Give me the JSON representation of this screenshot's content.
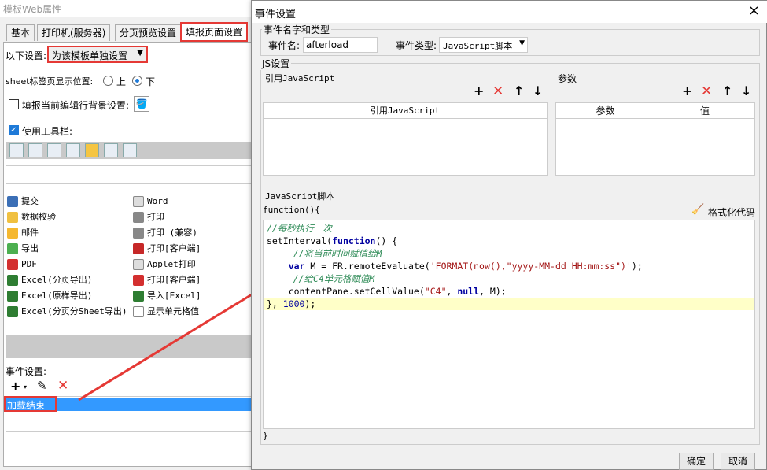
{
  "left_window": {
    "title": "模板Web属性",
    "tabs": [
      "基本",
      "打印机(服务器)",
      "分页预览设置",
      "填报页面设置"
    ],
    "selected_tab": 3,
    "settings_label": "以下设置:",
    "settings_value": "为该模板单独设置",
    "sheet_tab_label": "sheet标签页显示位置:",
    "sheet_tab_top": "上",
    "sheet_tab_bottom": "下",
    "bg_setting_label": "填报当前编辑行背景设置:",
    "toolbar_label": "使用工具栏:",
    "toolbar_items_left": [
      "提交",
      "数据校验",
      "邮件",
      "导出",
      "PDF",
      "Excel(分页导出)",
      "Excel(原样导出)",
      "Excel(分页分Sheet导出)"
    ],
    "toolbar_items_right": [
      "Word",
      "打印",
      "打印 (兼容)",
      "打印[客户端]",
      "Applet打印",
      "打印[客户端]",
      "导入[Excel]",
      "显示单元格值"
    ],
    "event_label": "事件设置:",
    "event_item": "加载结束"
  },
  "dialog": {
    "title": "事件设置",
    "close": "×",
    "name_type_group": "事件名字和类型",
    "event_name_label": "事件名:",
    "event_name_value": "afterload",
    "event_type_label": "事件类型:",
    "event_type_value": "JavaScript脚本",
    "js_group": "JS设置",
    "ref_js_label": "引用JavaScript",
    "ref_js_col": "引用JavaScript",
    "params_label": "参数",
    "params_cols": [
      "参数",
      "值"
    ],
    "script_label": "JavaScript脚本",
    "func_open": "function(){",
    "func_close": "}",
    "format_code": "格式化代码",
    "ok": "确定",
    "cancel": "取消",
    "code_lines": [
      "//每秒执行一次",
      "setInterval(function() {",
      "    //将当前时间赋值给M",
      "    var M = FR.remoteEvaluate('FORMAT(now(),\"yyyy-MM-dd HH:mm:ss\")');",
      "    //给C4单元格赋值M",
      "    contentPane.setCellValue(\"C4\", null, M);",
      "}, 1000);"
    ]
  },
  "colors": {
    "accent": "#e53935",
    "selection": "#3399ff",
    "highlight_line": "#ffffc8"
  }
}
